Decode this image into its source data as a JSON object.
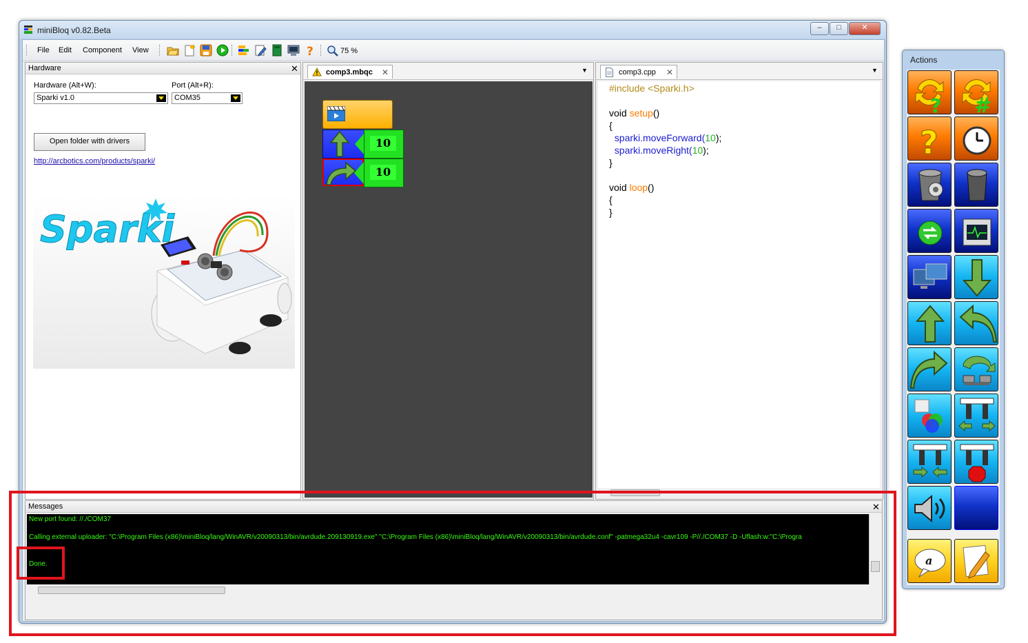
{
  "window": {
    "title": "miniBloq v0.82.Beta"
  },
  "menu": {
    "items": [
      "File",
      "Edit",
      "Component",
      "View"
    ]
  },
  "toolbar": {
    "zoom_label": "75 %"
  },
  "hardware_pane": {
    "title": "Hardware",
    "hardware_label": "Hardware (Alt+W):",
    "hardware_value": "Sparki v1.0",
    "port_label": "Port (Alt+R):",
    "port_value": "COM35",
    "drivers_button": "Open folder with drivers",
    "link": "http://arcbotics.com/products/sparki/",
    "logo_text": "Sparki"
  },
  "bloq_pane": {
    "tab_label": "comp3.mbqc",
    "blocks": [
      {
        "kind": "start",
        "value": ""
      },
      {
        "kind": "move-forward",
        "value": "10"
      },
      {
        "kind": "turn-right",
        "value": "10"
      }
    ]
  },
  "code_pane": {
    "tab_label": "comp3.cpp",
    "lines": {
      "l1a": "#include",
      "l1b": " <Sparki.h>",
      "l3a": "void ",
      "l3b": "setup",
      "l3c": "()",
      "l4": "{",
      "l5a": "  sparki.moveForward(",
      "l5b": "10",
      "l5c": ");",
      "l6a": "  sparki.moveRight(",
      "l6b": "10",
      "l6c": ");",
      "l7": "}",
      "l9a": "void ",
      "l9b": "loop",
      "l9c": "()",
      "l10": "{",
      "l11": "}"
    }
  },
  "messages": {
    "title": "Messages",
    "lines": [
      "New port found: //./COM37",
      "Calling external uploader: \"C:\\Program Files (x86)\\miniBloq/lang/WinAVR/v20090313/bin/avrdude.209130919.exe\" \"C:\\Program Files (x86)\\miniBloq/lang/WinAVR/v20090313/bin/avrdude.conf\" -patmega32u4 -cavr109 -P//./COM37 -D -Uflash:w:\"C:\\Progra",
      "Done."
    ]
  },
  "actions": {
    "title": "Actions",
    "buttons": [
      "loop-if-icon",
      "loop-hash-icon",
      "if-icon",
      "delay-clock-icon",
      "settings-bin-icon",
      "bin-icon",
      "serial-icon",
      "oscilloscope-icon",
      "monitor-icon",
      "arrow-down-icon",
      "arrow-up-icon",
      "turn-left-icon",
      "turn-right-icon",
      "gripper-rotate-icon",
      "rgb-led-icon",
      "gripper-open-icon",
      "gripper-close-icon",
      "gripper-stop-icon",
      "speaker-icon",
      "empty",
      "comment-icon",
      "edit-icon"
    ]
  },
  "colors": {
    "console_bg": "#000000",
    "console_text": "#39ff14",
    "highlight": "#e0141e",
    "block_start": "#ffb000",
    "block_arrow": "#1c2cf2",
    "block_value": "#22e022"
  }
}
